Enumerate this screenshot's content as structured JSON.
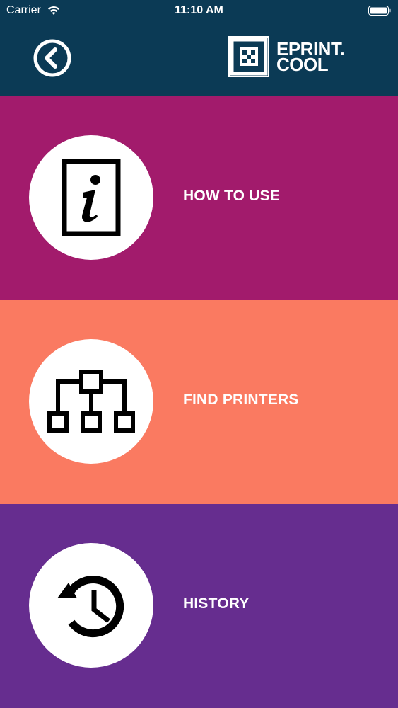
{
  "status_bar": {
    "carrier": "Carrier",
    "time": "11:10 AM"
  },
  "header": {
    "back_icon": "back-chevron-circle-icon",
    "logo": {
      "line1": "EPRINT.",
      "line2": "COOL"
    }
  },
  "menu": {
    "items": [
      {
        "label": "HOW TO USE",
        "icon": "info-document-icon",
        "color": "#a21b6c"
      },
      {
        "label": "FIND PRINTERS",
        "icon": "network-tree-icon",
        "color": "#fa7a61"
      },
      {
        "label": "HISTORY",
        "icon": "history-clock-icon",
        "color": "#662d8f"
      }
    ]
  },
  "colors": {
    "header_bg": "#0b3a55",
    "text": "#ffffff"
  }
}
